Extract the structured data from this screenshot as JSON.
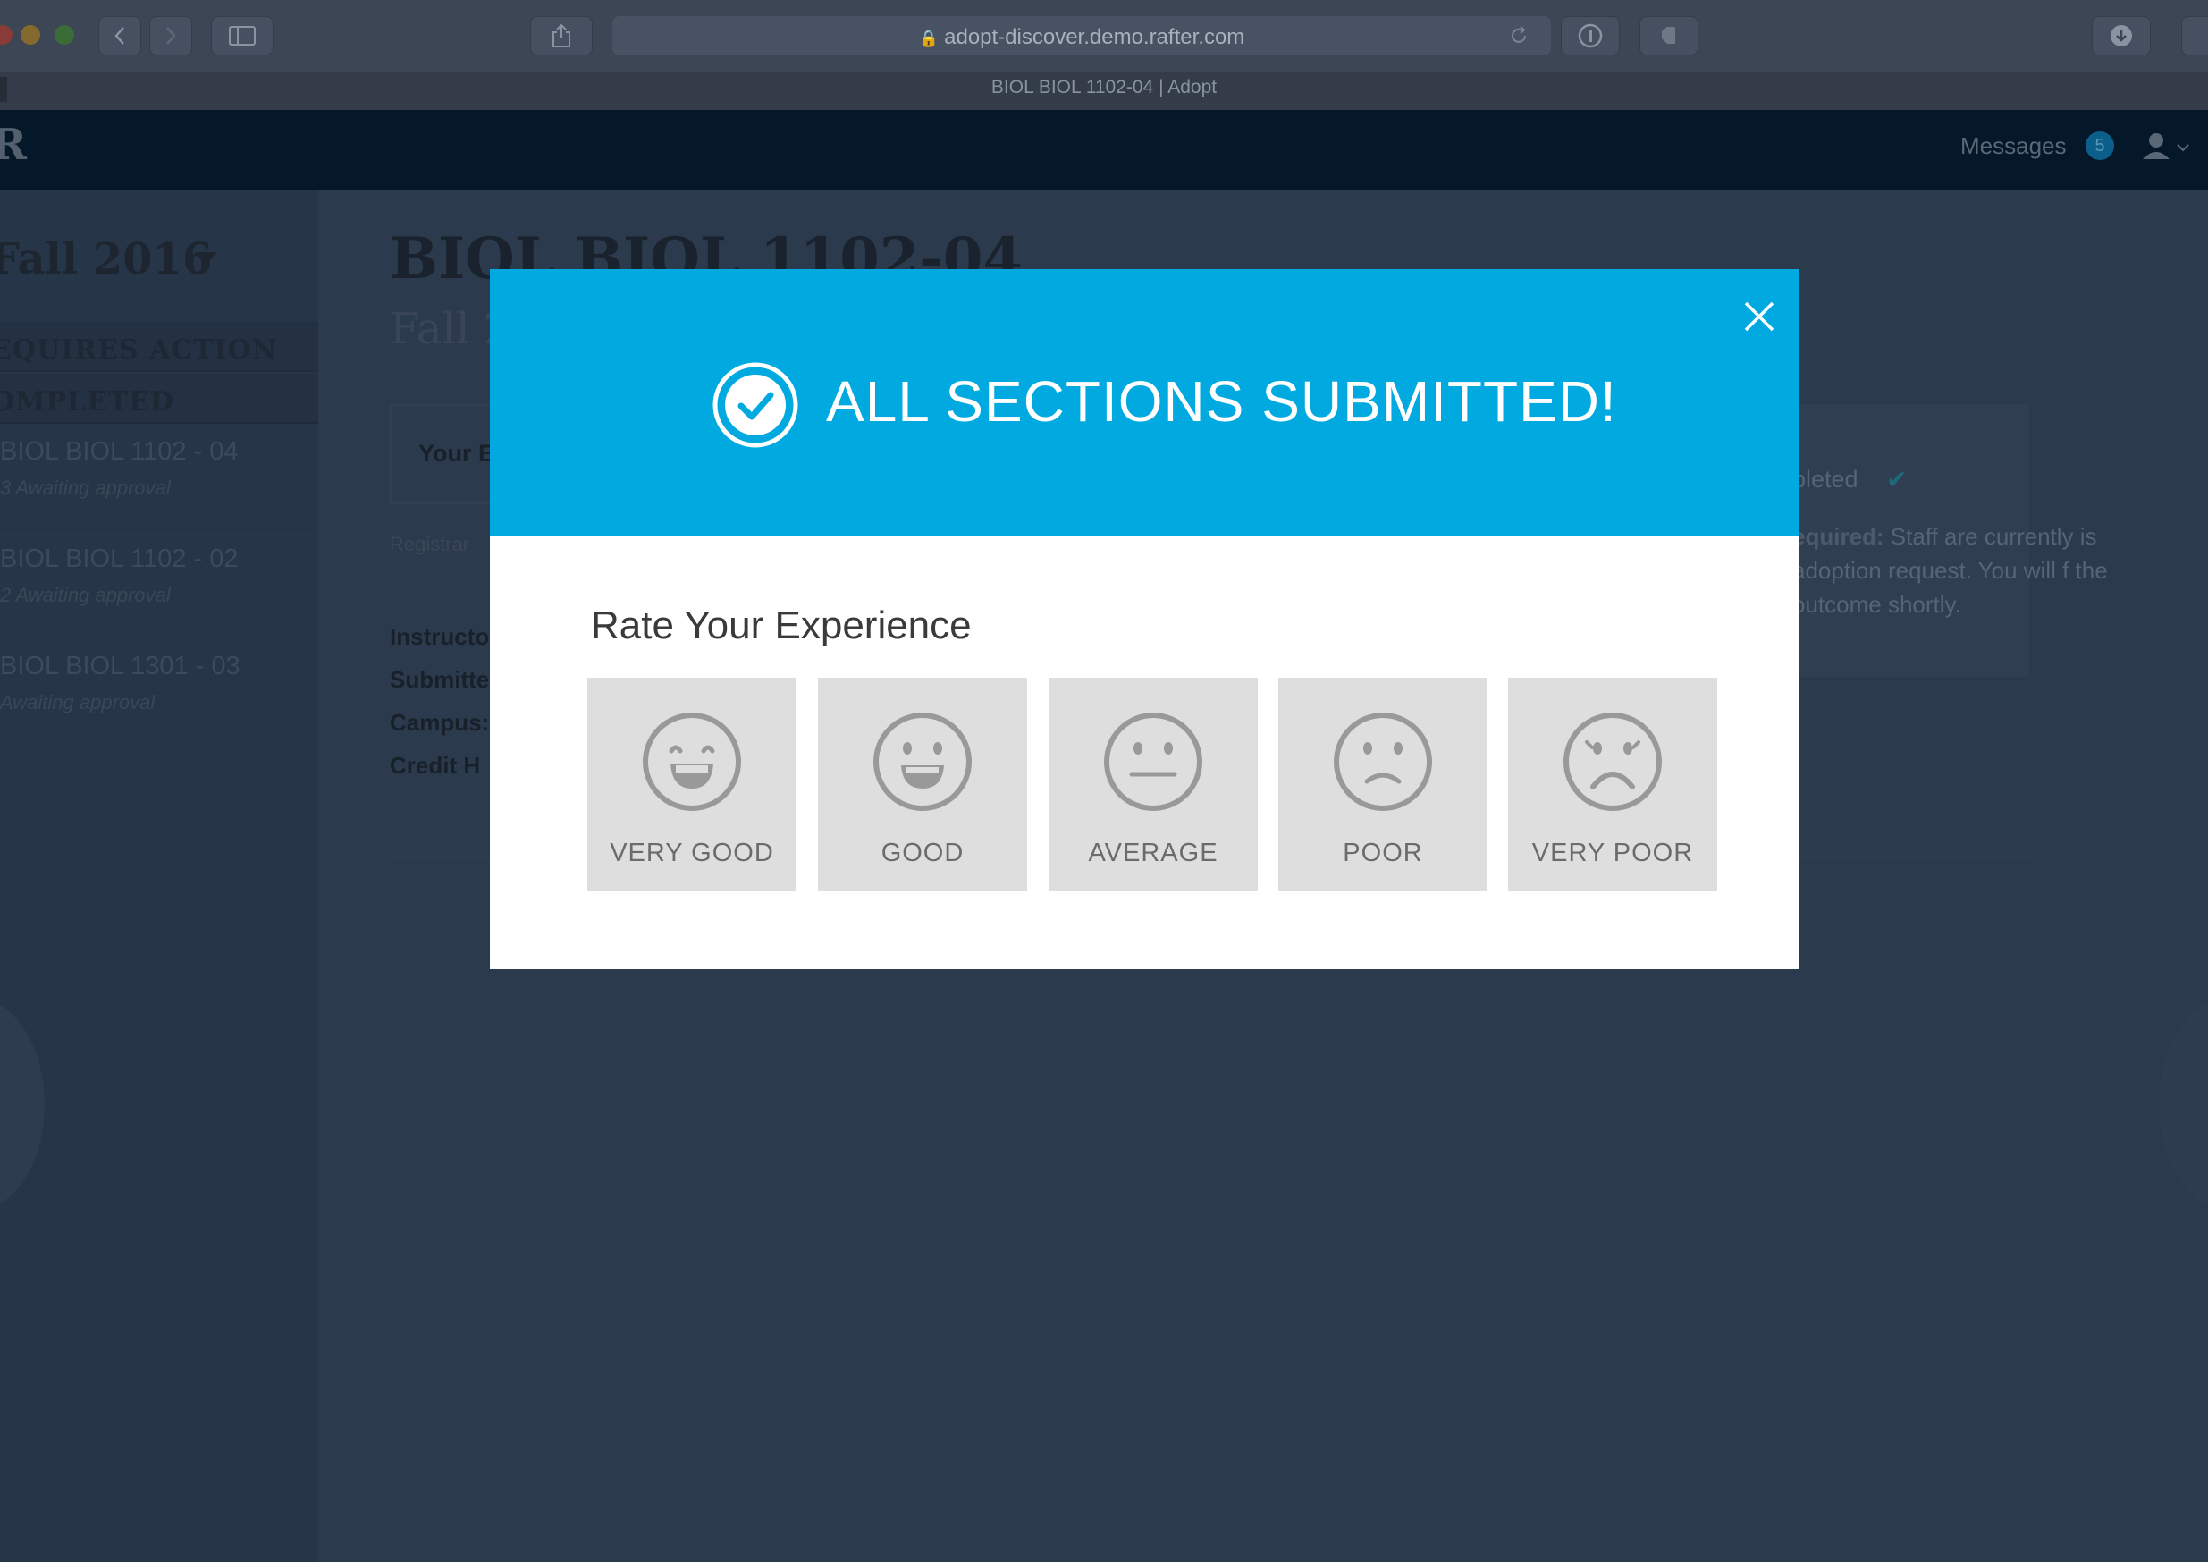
{
  "browser": {
    "url": "adopt-discover.demo.rafter.com",
    "tab_title": "BIOL BIOL 1102-04 | Adopt"
  },
  "appnav": {
    "logo": "R",
    "messages_label": "Messages",
    "messages_count": "5"
  },
  "sidebar": {
    "term": "Fall 2016",
    "filters": [
      "EQUIRES ACTION",
      "OMPLETED"
    ],
    "courses": [
      {
        "name": "BIOL BIOL 1102 - 04",
        "status": "3 Awaiting approval"
      },
      {
        "name": "BIOL BIOL 1102 - 02",
        "status": "2 Awaiting approval"
      },
      {
        "name": "BIOL BIOL 1301 - 03",
        "status": "Awaiting approval"
      }
    ]
  },
  "main": {
    "title": "BIOL BIOL 1102-04",
    "subtitle": "Fall 2",
    "your_box": "Your E",
    "registrar": "Registrar",
    "details": [
      "Instructo",
      "Submitte",
      "Campus:",
      "Credit H"
    ],
    "right_panel": {
      "completed": "pleted",
      "required_label": "equired:",
      "required_text": " Staff are currently is adoption request. You will f the outcome shortly."
    }
  },
  "modal": {
    "title": "ALL SECTIONS SUBMITTED!",
    "rate_title": "Rate Your Experience",
    "ratings": [
      {
        "label": "VERY GOOD",
        "icon": "very-good-face-icon"
      },
      {
        "label": "GOOD",
        "icon": "good-face-icon"
      },
      {
        "label": "AVERAGE",
        "icon": "average-face-icon"
      },
      {
        "label": "POOR",
        "icon": "poor-face-icon"
      },
      {
        "label": "VERY POOR",
        "icon": "very-poor-face-icon"
      }
    ]
  },
  "colors": {
    "modal_header": "#00aae0",
    "overlay_background": "#2b3a4c",
    "rating_card": "#dedede",
    "face_stroke": "#999999"
  }
}
